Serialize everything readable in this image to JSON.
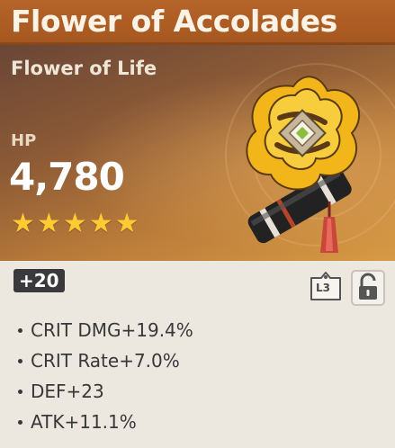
{
  "artifact": {
    "name": "Flower of Accolades",
    "type": "Flower of Life",
    "main_stat": {
      "name": "HP",
      "value": "4,780"
    },
    "rarity_stars": 5,
    "level": "+20",
    "tag": "L3",
    "locked": false,
    "substats": [
      {
        "label": "CRIT DMG+19.4%"
      },
      {
        "label": "CRIT Rate+7.0%"
      },
      {
        "label": "DEF+23"
      },
      {
        "label": "ATK+11.1%"
      }
    ]
  },
  "colors": {
    "title_bar": "#b5642a",
    "star": "#ffcb33",
    "panel": "#ece7df",
    "level_badge": "#3a3a3c"
  },
  "icons": {
    "star": "star-icon",
    "tag": "tag-icon",
    "lock": "unlock-icon"
  }
}
